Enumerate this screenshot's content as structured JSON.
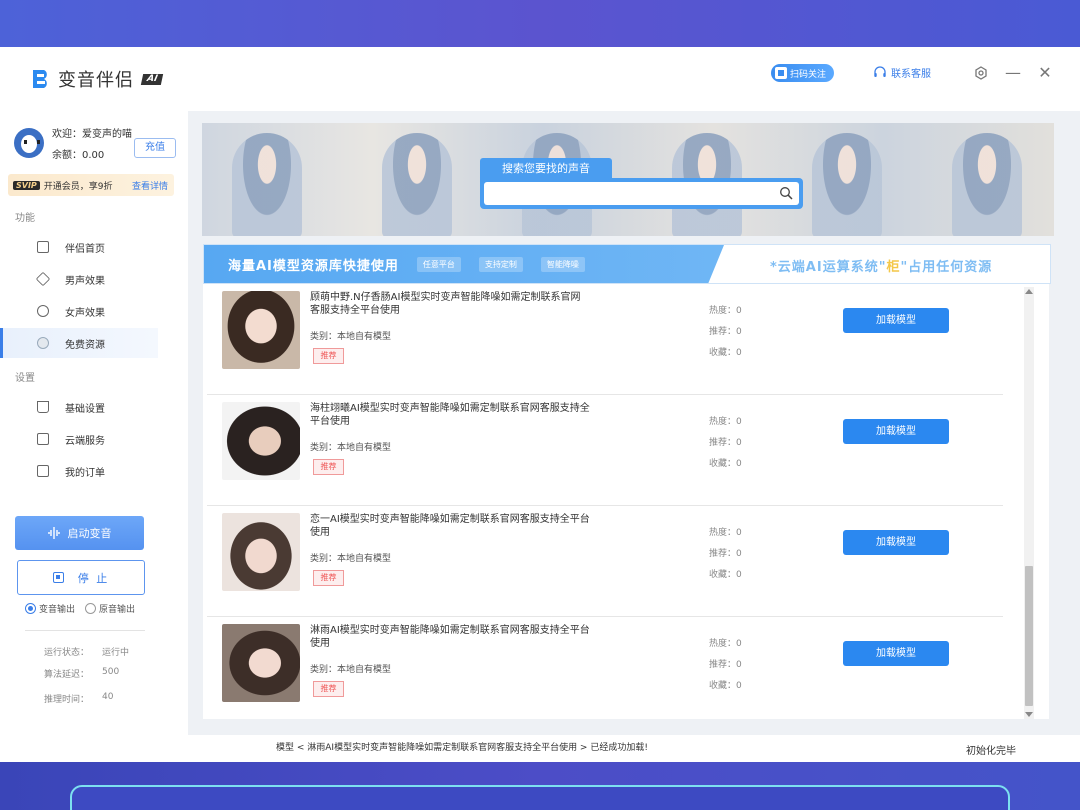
{
  "app": {
    "name": "变音伴侣",
    "badge": "AI"
  },
  "header": {
    "scan_label": "扫码关注",
    "contact_label": "联系客服"
  },
  "user": {
    "welcome": "欢迎：爱变声的喵",
    "balance": "余额：0.00",
    "recharge": "充值"
  },
  "svip": {
    "tag": "SVIP",
    "text": "开通会员，享9折",
    "detail": "查看详情"
  },
  "sidebar": {
    "section_func": "功能",
    "func_items": [
      {
        "label": "伴侣首页",
        "icon": "home-icon"
      },
      {
        "label": "男声效果",
        "icon": "layers-icon"
      },
      {
        "label": "女声效果",
        "icon": "gear-icon"
      },
      {
        "label": "免费资源",
        "icon": "globe-icon",
        "active": true
      }
    ],
    "section_settings": "设置",
    "settings_items": [
      {
        "label": "基础设置",
        "icon": "cart-icon"
      },
      {
        "label": "云端服务",
        "icon": "card-icon"
      },
      {
        "label": "我的订单",
        "icon": "box-icon"
      }
    ],
    "start_label": "启动变音",
    "stop_label": "停  止",
    "radio_voice": "变音输出",
    "radio_original": "原音输出",
    "stats": [
      {
        "label": "运行状态：",
        "value": "运行中"
      },
      {
        "label": "算法延迟：",
        "value": "500"
      },
      {
        "label": "推理时间：",
        "value": "40"
      }
    ]
  },
  "search": {
    "label": "搜索您要找的声音",
    "placeholder": ""
  },
  "strip": {
    "title": "海量AI模型资源库快捷使用",
    "pills": [
      "任意平台",
      "支持定制",
      "智能降噪"
    ],
    "slogan_pre": "*云端AI运算系统\"",
    "slogan_hl": "柜",
    "slogan_post": "\"占用任何资源"
  },
  "models": [
    {
      "title": "顾萌中野.N仔香肠AI模型实时变声智能降噪如需定制联系官网客服支持全平台使用",
      "category": "类别：本地自有模型",
      "tag": "推荐",
      "heat": "热度：0",
      "recommend": "推荐：0",
      "fav": "收藏：0",
      "button": "加载模型"
    },
    {
      "title": "海柱翊曦AI模型实时变声智能降噪如需定制联系官网客服支持全平台使用",
      "category": "类别：本地自有模型",
      "tag": "推荐",
      "heat": "热度：0",
      "recommend": "推荐：0",
      "fav": "收藏：0",
      "button": "加载模型"
    },
    {
      "title": "恋一AI模型实时变声智能降噪如需定制联系官网客服支持全平台使用",
      "category": "类别：本地自有模型",
      "tag": "推荐",
      "heat": "热度：0",
      "recommend": "推荐：0",
      "fav": "收藏：0",
      "button": "加载模型"
    },
    {
      "title": "淋雨AI模型实时变声智能降噪如需定制联系官网客服支持全平台使用",
      "category": "类别：本地自有模型",
      "tag": "推荐",
      "heat": "热度：0",
      "recommend": "推荐：0",
      "fav": "收藏：0",
      "button": "加载模型"
    }
  ],
  "status": {
    "message": "模型 < 淋雨AI模型实时变声智能降噪如需定制联系官网客服支持全平台使用 > 已经成功加载!",
    "right": "初始化完毕"
  },
  "colors": {
    "accent": "#2b88f0",
    "strip": "#57a8f2",
    "tag_red": "#e55555"
  }
}
